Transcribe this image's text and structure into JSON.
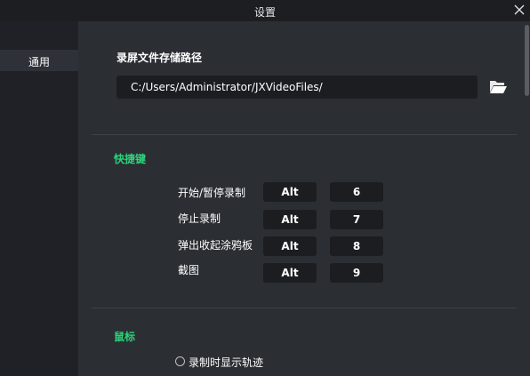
{
  "window": {
    "title": "设置"
  },
  "sidebar": {
    "items": [
      {
        "label": "通用"
      }
    ]
  },
  "recording": {
    "path_label": "录屏文件存储路径",
    "path_value": "C:/Users/Administrator/JXVideoFiles/"
  },
  "shortcuts": {
    "title": "快捷键",
    "items": [
      {
        "label": "开始/暂停录制",
        "modifier": "Alt",
        "key": "6"
      },
      {
        "label": "停止录制",
        "modifier": "Alt",
        "key": "7"
      },
      {
        "label": "弹出收起涂鸦板",
        "modifier": "Alt",
        "key": "8"
      },
      {
        "label": "截图",
        "modifier": "Alt",
        "key": "9"
      }
    ]
  },
  "mouse": {
    "title": "鼠标",
    "show_trail_label": "录制时显示轨迹",
    "show_trail_checked": false
  },
  "colors": {
    "accent_green": "#2bd47a",
    "background": "#2b2e33",
    "sidebar": "#1f2126",
    "field": "#1c1d20"
  }
}
